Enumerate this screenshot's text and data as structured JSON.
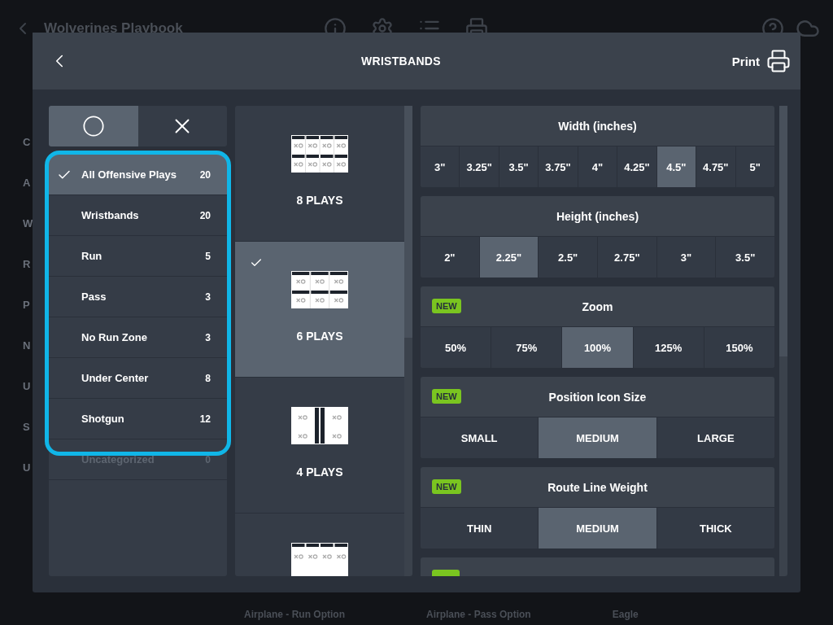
{
  "background": {
    "title": "Wolverines Playbook",
    "sidebar_fragments": [
      "C",
      "A",
      "W",
      "R",
      "P",
      "N",
      "U",
      "S",
      "U"
    ],
    "card_titles": [
      "Airplane - Run Option",
      "Airplane - Pass Option",
      "Eagle"
    ]
  },
  "dialog": {
    "title": "WRISTBANDS",
    "print_label": "Print"
  },
  "mode_toggle": [
    {
      "kind": "offense",
      "selected": true
    },
    {
      "kind": "defense",
      "selected": false
    }
  ],
  "categories": [
    {
      "label": "All Offensive Plays",
      "count": "20",
      "selected": true,
      "disabled": false
    },
    {
      "label": "Wristbands",
      "count": "20",
      "selected": false,
      "disabled": false
    },
    {
      "label": "Run",
      "count": "5",
      "selected": false,
      "disabled": false
    },
    {
      "label": "Pass",
      "count": "3",
      "selected": false,
      "disabled": false
    },
    {
      "label": "No Run Zone",
      "count": "3",
      "selected": false,
      "disabled": false
    },
    {
      "label": "Under Center",
      "count": "8",
      "selected": false,
      "disabled": false
    },
    {
      "label": "Shotgun",
      "count": "12",
      "selected": false,
      "disabled": false
    },
    {
      "label": "Uncategorized",
      "count": "0",
      "selected": false,
      "disabled": true
    }
  ],
  "layouts": [
    {
      "kind": "cols4",
      "label": "8 PLAYS",
      "selected": false
    },
    {
      "kind": "cols3",
      "label": "6 PLAYS",
      "selected": true
    },
    {
      "kind": "split",
      "label": "4 PLAYS",
      "selected": false
    },
    {
      "kind": "vertical",
      "selected": false
    }
  ],
  "settings": [
    {
      "title": "Width (inches)",
      "new": false,
      "options": [
        {
          "label": "3\"",
          "selected": false
        },
        {
          "label": "3.25\"",
          "selected": false
        },
        {
          "label": "3.5\"",
          "selected": false
        },
        {
          "label": "3.75\"",
          "selected": false
        },
        {
          "label": "4\"",
          "selected": false
        },
        {
          "label": "4.25\"",
          "selected": false
        },
        {
          "label": "4.5\"",
          "selected": true
        },
        {
          "label": "4.75\"",
          "selected": false
        },
        {
          "label": "5\"",
          "selected": false
        }
      ]
    },
    {
      "title": "Height (inches)",
      "new": false,
      "options": [
        {
          "label": "2\"",
          "selected": false
        },
        {
          "label": "2.25\"",
          "selected": true
        },
        {
          "label": "2.5\"",
          "selected": false
        },
        {
          "label": "2.75\"",
          "selected": false
        },
        {
          "label": "3\"",
          "selected": false
        },
        {
          "label": "3.5\"",
          "selected": false
        }
      ]
    },
    {
      "title": "Zoom",
      "new": true,
      "badge": "NEW",
      "options": [
        {
          "label": "50%",
          "selected": false
        },
        {
          "label": "75%",
          "selected": false
        },
        {
          "label": "100%",
          "selected": true
        },
        {
          "label": "125%",
          "selected": false
        },
        {
          "label": "150%",
          "selected": false
        }
      ]
    },
    {
      "title": "Position Icon Size",
      "new": true,
      "badge": "NEW",
      "options": [
        {
          "label": "SMALL",
          "selected": false
        },
        {
          "label": "MEDIUM",
          "selected": true
        },
        {
          "label": "LARGE",
          "selected": false
        }
      ]
    },
    {
      "title": "Route Line Weight",
      "new": true,
      "badge": "NEW",
      "options": [
        {
          "label": "THIN",
          "selected": false
        },
        {
          "label": "MEDIUM",
          "selected": true
        },
        {
          "label": "THICK",
          "selected": false
        }
      ]
    }
  ]
}
